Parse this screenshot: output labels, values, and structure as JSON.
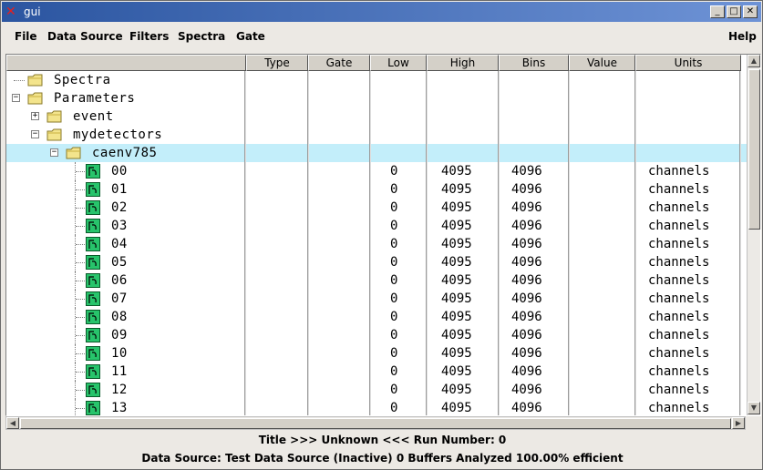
{
  "window": {
    "title": "gui"
  },
  "menubar": {
    "items": [
      "File",
      "Data Source",
      "Filters",
      "Spectra",
      "Gate"
    ],
    "help": "Help"
  },
  "table": {
    "columns": [
      "",
      "Type",
      "Gate",
      "Low",
      "High",
      "Bins",
      "Value",
      "Units"
    ],
    "tree": [
      {
        "label": "Spectra",
        "level": 0,
        "kind": "folder",
        "expander": ""
      },
      {
        "label": "Parameters",
        "level": 0,
        "kind": "folder",
        "expander": "−"
      },
      {
        "label": "event",
        "level": 1,
        "kind": "folder",
        "expander": "+"
      },
      {
        "label": "mydetectors",
        "level": 1,
        "kind": "folder",
        "expander": "−"
      },
      {
        "label": "caenv785",
        "level": 2,
        "kind": "folder",
        "expander": "−",
        "selected": true
      }
    ],
    "parameters": [
      {
        "name": "00",
        "low": "0",
        "high": "4095",
        "bins": "4096",
        "units": "channels"
      },
      {
        "name": "01",
        "low": "0",
        "high": "4095",
        "bins": "4096",
        "units": "channels"
      },
      {
        "name": "02",
        "low": "0",
        "high": "4095",
        "bins": "4096",
        "units": "channels"
      },
      {
        "name": "03",
        "low": "0",
        "high": "4095",
        "bins": "4096",
        "units": "channels"
      },
      {
        "name": "04",
        "low": "0",
        "high": "4095",
        "bins": "4096",
        "units": "channels"
      },
      {
        "name": "05",
        "low": "0",
        "high": "4095",
        "bins": "4096",
        "units": "channels"
      },
      {
        "name": "06",
        "low": "0",
        "high": "4095",
        "bins": "4096",
        "units": "channels"
      },
      {
        "name": "07",
        "low": "0",
        "high": "4095",
        "bins": "4096",
        "units": "channels"
      },
      {
        "name": "08",
        "low": "0",
        "high": "4095",
        "bins": "4096",
        "units": "channels"
      },
      {
        "name": "09",
        "low": "0",
        "high": "4095",
        "bins": "4096",
        "units": "channels"
      },
      {
        "name": "10",
        "low": "0",
        "high": "4095",
        "bins": "4096",
        "units": "channels"
      },
      {
        "name": "11",
        "low": "0",
        "high": "4095",
        "bins": "4096",
        "units": "channels"
      },
      {
        "name": "12",
        "low": "0",
        "high": "4095",
        "bins": "4096",
        "units": "channels"
      },
      {
        "name": "13",
        "low": "0",
        "high": "4095",
        "bins": "4096",
        "units": "channels"
      }
    ]
  },
  "status": {
    "line1": "Title >>> Unknown <<< Run Number: 0",
    "line2": "Data Source: Test Data Source (Inactive) 0 Buffers Analyzed 100.00% efficient"
  },
  "colors": {
    "selection": "#c3eefa",
    "folder": "#f3e48c",
    "parameter_icon": "#27c46b",
    "titlebar": "#2b55a0"
  }
}
